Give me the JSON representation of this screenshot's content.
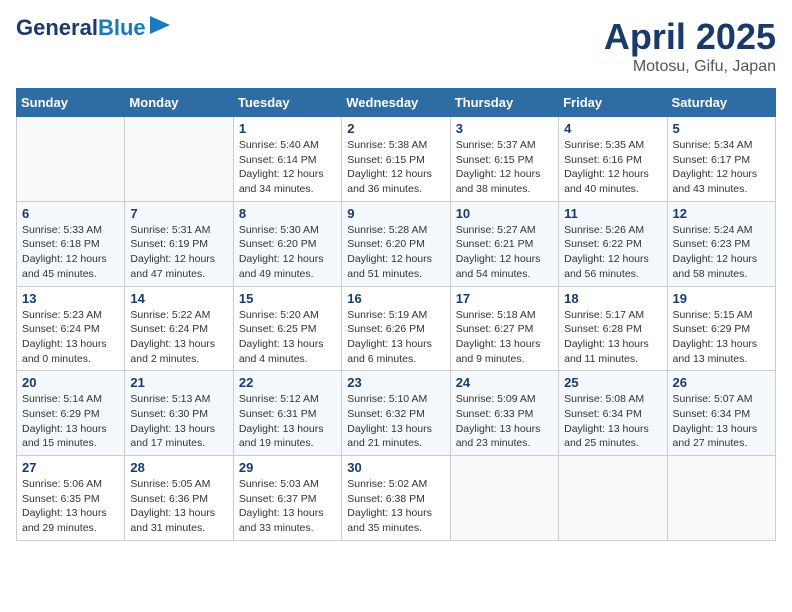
{
  "header": {
    "logo_line1": "General",
    "logo_line2": "Blue",
    "month": "April 2025",
    "location": "Motosu, Gifu, Japan"
  },
  "weekdays": [
    "Sunday",
    "Monday",
    "Tuesday",
    "Wednesday",
    "Thursday",
    "Friday",
    "Saturday"
  ],
  "weeks": [
    [
      {
        "day": "",
        "detail": ""
      },
      {
        "day": "",
        "detail": ""
      },
      {
        "day": "1",
        "detail": "Sunrise: 5:40 AM\nSunset: 6:14 PM\nDaylight: 12 hours\nand 34 minutes."
      },
      {
        "day": "2",
        "detail": "Sunrise: 5:38 AM\nSunset: 6:15 PM\nDaylight: 12 hours\nand 36 minutes."
      },
      {
        "day": "3",
        "detail": "Sunrise: 5:37 AM\nSunset: 6:15 PM\nDaylight: 12 hours\nand 38 minutes."
      },
      {
        "day": "4",
        "detail": "Sunrise: 5:35 AM\nSunset: 6:16 PM\nDaylight: 12 hours\nand 40 minutes."
      },
      {
        "day": "5",
        "detail": "Sunrise: 5:34 AM\nSunset: 6:17 PM\nDaylight: 12 hours\nand 43 minutes."
      }
    ],
    [
      {
        "day": "6",
        "detail": "Sunrise: 5:33 AM\nSunset: 6:18 PM\nDaylight: 12 hours\nand 45 minutes."
      },
      {
        "day": "7",
        "detail": "Sunrise: 5:31 AM\nSunset: 6:19 PM\nDaylight: 12 hours\nand 47 minutes."
      },
      {
        "day": "8",
        "detail": "Sunrise: 5:30 AM\nSunset: 6:20 PM\nDaylight: 12 hours\nand 49 minutes."
      },
      {
        "day": "9",
        "detail": "Sunrise: 5:28 AM\nSunset: 6:20 PM\nDaylight: 12 hours\nand 51 minutes."
      },
      {
        "day": "10",
        "detail": "Sunrise: 5:27 AM\nSunset: 6:21 PM\nDaylight: 12 hours\nand 54 minutes."
      },
      {
        "day": "11",
        "detail": "Sunrise: 5:26 AM\nSunset: 6:22 PM\nDaylight: 12 hours\nand 56 minutes."
      },
      {
        "day": "12",
        "detail": "Sunrise: 5:24 AM\nSunset: 6:23 PM\nDaylight: 12 hours\nand 58 minutes."
      }
    ],
    [
      {
        "day": "13",
        "detail": "Sunrise: 5:23 AM\nSunset: 6:24 PM\nDaylight: 13 hours\nand 0 minutes."
      },
      {
        "day": "14",
        "detail": "Sunrise: 5:22 AM\nSunset: 6:24 PM\nDaylight: 13 hours\nand 2 minutes."
      },
      {
        "day": "15",
        "detail": "Sunrise: 5:20 AM\nSunset: 6:25 PM\nDaylight: 13 hours\nand 4 minutes."
      },
      {
        "day": "16",
        "detail": "Sunrise: 5:19 AM\nSunset: 6:26 PM\nDaylight: 13 hours\nand 6 minutes."
      },
      {
        "day": "17",
        "detail": "Sunrise: 5:18 AM\nSunset: 6:27 PM\nDaylight: 13 hours\nand 9 minutes."
      },
      {
        "day": "18",
        "detail": "Sunrise: 5:17 AM\nSunset: 6:28 PM\nDaylight: 13 hours\nand 11 minutes."
      },
      {
        "day": "19",
        "detail": "Sunrise: 5:15 AM\nSunset: 6:29 PM\nDaylight: 13 hours\nand 13 minutes."
      }
    ],
    [
      {
        "day": "20",
        "detail": "Sunrise: 5:14 AM\nSunset: 6:29 PM\nDaylight: 13 hours\nand 15 minutes."
      },
      {
        "day": "21",
        "detail": "Sunrise: 5:13 AM\nSunset: 6:30 PM\nDaylight: 13 hours\nand 17 minutes."
      },
      {
        "day": "22",
        "detail": "Sunrise: 5:12 AM\nSunset: 6:31 PM\nDaylight: 13 hours\nand 19 minutes."
      },
      {
        "day": "23",
        "detail": "Sunrise: 5:10 AM\nSunset: 6:32 PM\nDaylight: 13 hours\nand 21 minutes."
      },
      {
        "day": "24",
        "detail": "Sunrise: 5:09 AM\nSunset: 6:33 PM\nDaylight: 13 hours\nand 23 minutes."
      },
      {
        "day": "25",
        "detail": "Sunrise: 5:08 AM\nSunset: 6:34 PM\nDaylight: 13 hours\nand 25 minutes."
      },
      {
        "day": "26",
        "detail": "Sunrise: 5:07 AM\nSunset: 6:34 PM\nDaylight: 13 hours\nand 27 minutes."
      }
    ],
    [
      {
        "day": "27",
        "detail": "Sunrise: 5:06 AM\nSunset: 6:35 PM\nDaylight: 13 hours\nand 29 minutes."
      },
      {
        "day": "28",
        "detail": "Sunrise: 5:05 AM\nSunset: 6:36 PM\nDaylight: 13 hours\nand 31 minutes."
      },
      {
        "day": "29",
        "detail": "Sunrise: 5:03 AM\nSunset: 6:37 PM\nDaylight: 13 hours\nand 33 minutes."
      },
      {
        "day": "30",
        "detail": "Sunrise: 5:02 AM\nSunset: 6:38 PM\nDaylight: 13 hours\nand 35 minutes."
      },
      {
        "day": "",
        "detail": ""
      },
      {
        "day": "",
        "detail": ""
      },
      {
        "day": "",
        "detail": ""
      }
    ]
  ]
}
